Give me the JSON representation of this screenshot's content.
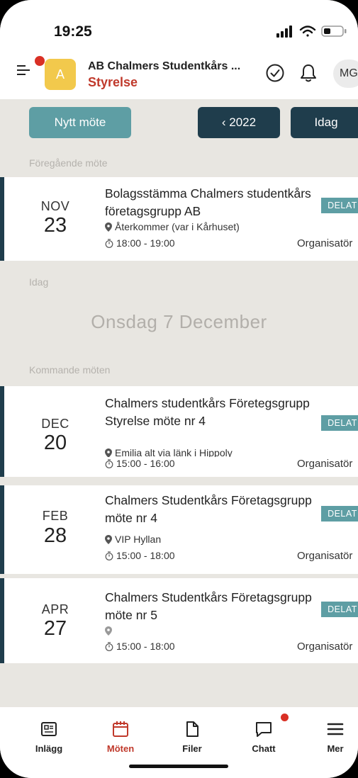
{
  "status": {
    "time": "19:25"
  },
  "header": {
    "org_initial": "A",
    "org_name": "AB Chalmers Studentkårs ...",
    "org_sub": "Styrelse",
    "avatar": "MG"
  },
  "toolbar": {
    "new_meeting": "Nytt möte",
    "year": "‹ 2022",
    "today": "Idag"
  },
  "sections": {
    "previous": "Föregående möte",
    "today": "Idag",
    "upcoming": "Kommande möten"
  },
  "today_date": "Onsdag 7 December",
  "meetings": [
    {
      "month": "NOV",
      "day": "23",
      "title": "Bolagsstämma Chalmers studentkårs företagsgrupp AB",
      "location": "Återkommer (var i Kårhuset)",
      "time": "18:00 - 19:00",
      "badge": "DELAT",
      "role": "Organisatör"
    },
    {
      "month": "DEC",
      "day": "20",
      "title": "Chalmers studentkårs Företegsgrupp Styrelse möte nr 4",
      "location": "Emilia alt via länk i Hippoly",
      "time": "15:00 - 16:00",
      "badge": "DELAT",
      "role": "Organisatör"
    },
    {
      "month": "FEB",
      "day": "28",
      "title": "Chalmers Studentkårs Företagsgrupp möte nr 4",
      "location": "VIP Hyllan",
      "time": "15:00 - 18:00",
      "badge": "DELAT",
      "role": "Organisatör"
    },
    {
      "month": "APR",
      "day": "27",
      "title": "Chalmers Studentkårs Företagsgrupp möte nr 5",
      "location": "",
      "time": "15:00 - 18:00",
      "badge": "DELAT",
      "role": "Organisatör"
    }
  ],
  "tabs": [
    {
      "label": "Inlägg",
      "icon": "news-icon"
    },
    {
      "label": "Möten",
      "icon": "calendar-icon",
      "active": true
    },
    {
      "label": "Filer",
      "icon": "file-icon"
    },
    {
      "label": "Chatt",
      "icon": "chat-icon"
    },
    {
      "label": "Mer",
      "icon": "menu-icon"
    }
  ],
  "colors": {
    "accent_teal": "#5e9ea4",
    "navy": "#1f3d4c",
    "brand_red": "#c0392b",
    "background": "#e8e6e1"
  }
}
